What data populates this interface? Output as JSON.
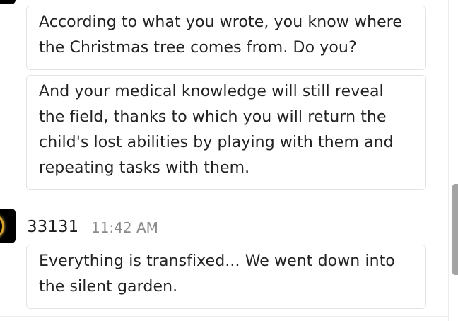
{
  "messages": {
    "previous": [
      {
        "text": "According to what you wrote, you know where the Christmas tree comes from. Do you?"
      },
      {
        "text": "And your medical knowledge will still reveal the field, thanks to which you will return the child's lost abilities by playing with them and repeating tasks with them."
      }
    ],
    "current": {
      "username": "33131",
      "timestamp": "11:42 AM",
      "text": "Everything is transfixed... We went down into the silent garden."
    }
  },
  "colors": {
    "bubble_border": "#e3e3e3",
    "timestamp": "#8a8a8a",
    "avatar_ring": "#d9a42c"
  }
}
